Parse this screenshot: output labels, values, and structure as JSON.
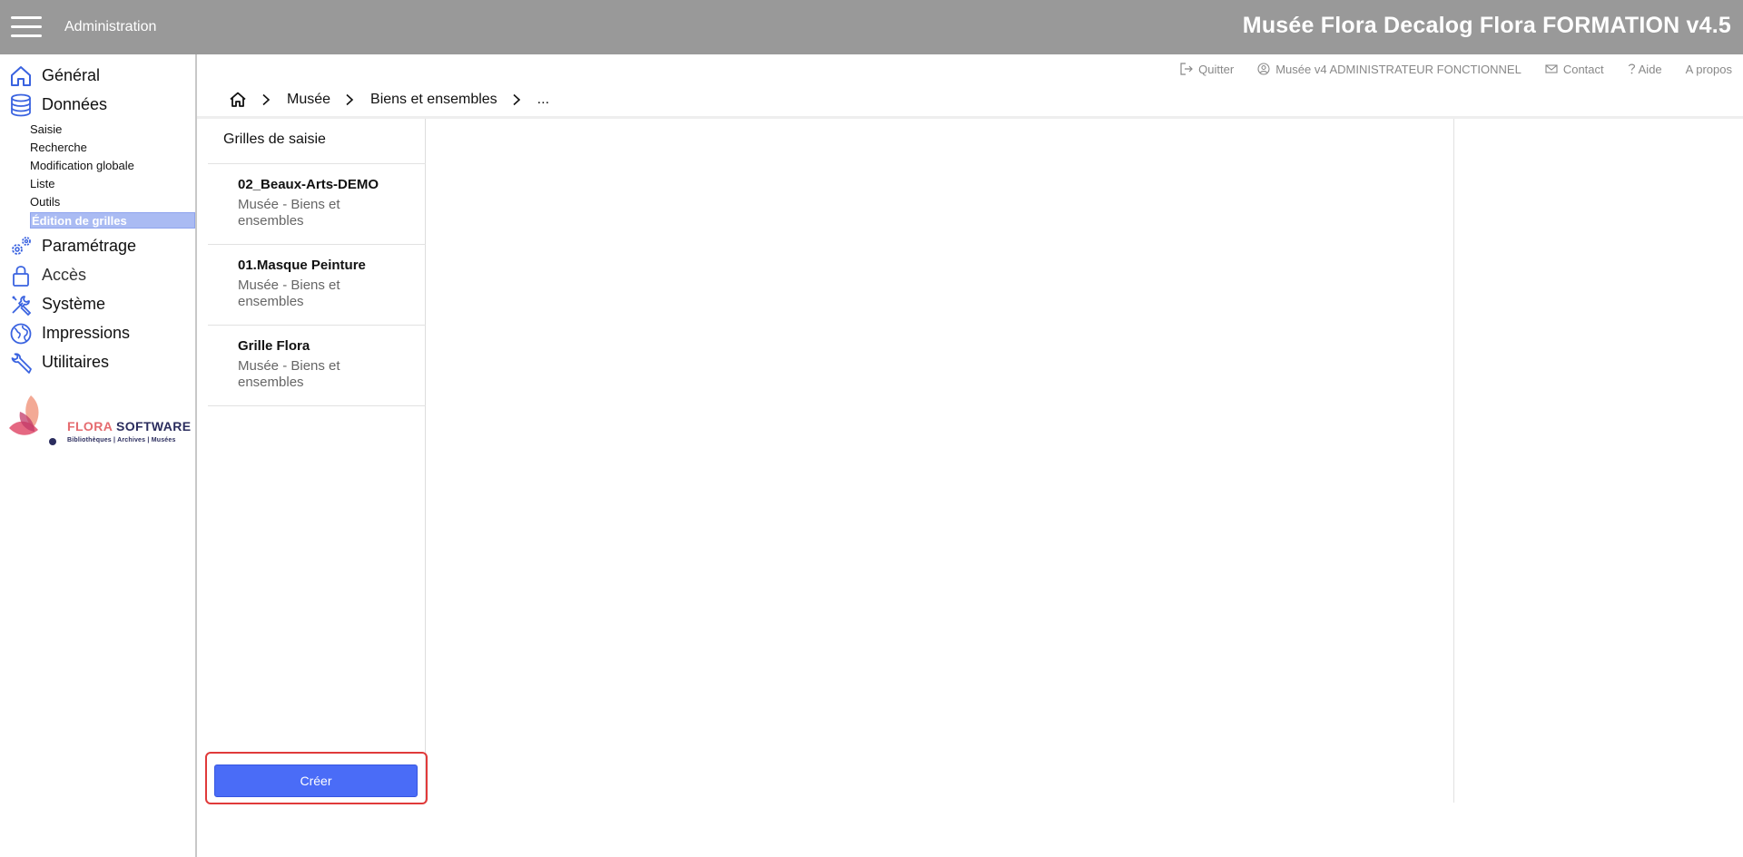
{
  "topbar": {
    "section": "Administration",
    "title": "Musée Flora Decalog Flora FORMATION v4.5"
  },
  "sidebar": {
    "items": [
      {
        "label": "Général",
        "icon": "home-icon"
      },
      {
        "label": "Données",
        "icon": "database-icon"
      },
      {
        "label": "Paramétrage",
        "icon": "gears-icon"
      },
      {
        "label": "Accès",
        "icon": "lock-icon"
      },
      {
        "label": "Système",
        "icon": "tools-icon"
      },
      {
        "label": "Impressions",
        "icon": "globe-icon"
      },
      {
        "label": "Utilitaires",
        "icon": "wrench-icon"
      }
    ],
    "subitems": [
      "Saisie",
      "Recherche",
      "Modification globale",
      "Liste",
      "Outils",
      "Édition de grilles"
    ],
    "active_subitem": "Édition de grilles",
    "logo": {
      "brand_a": "FLORA",
      "brand_b": "SOFTWARE",
      "tagline": "Bibliothèques | Archives | Musées"
    }
  },
  "toplinks": {
    "quit": "Quitter",
    "user": "Musée v4 ADMINISTRATEUR FONCTIONNEL",
    "contact": "Contact",
    "help": "Aide",
    "about": "A propos"
  },
  "breadcrumb": {
    "items": [
      "Musée",
      "Biens et ensembles",
      "..."
    ]
  },
  "panel": {
    "title": "Grilles de saisie",
    "grids": [
      {
        "name": "02_Beaux-Arts-DEMO",
        "sub": "Musée - Biens et ensembles"
      },
      {
        "name": "01.Masque Peinture",
        "sub": "Musée - Biens et ensembles"
      },
      {
        "name": "Grille Flora",
        "sub": "Musée - Biens et ensembles"
      }
    ],
    "create_label": "Créer"
  },
  "colors": {
    "topbar": "#999999",
    "accent": "#4a6cf7",
    "active_bg": "#aabbf3",
    "icon_blue": "#3a63e0",
    "highlight_border": "#e03a3a"
  }
}
